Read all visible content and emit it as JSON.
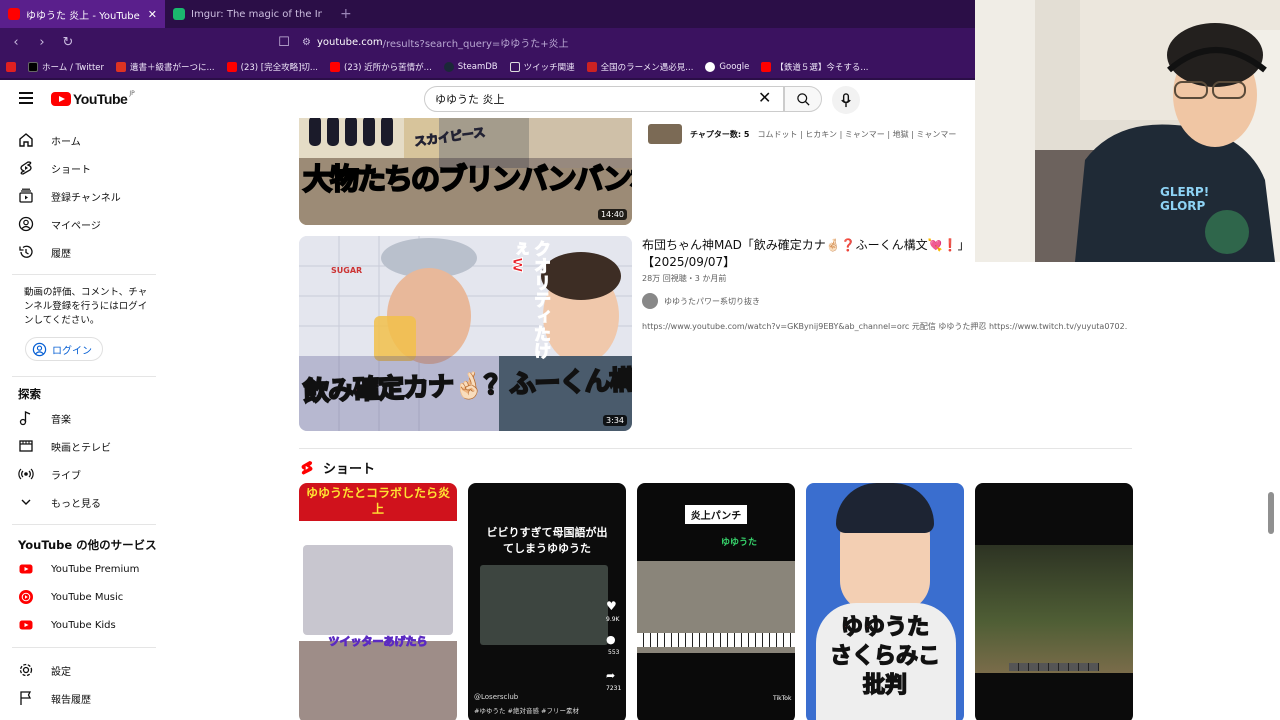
{
  "browser": {
    "tabs": [
      {
        "label": "ゆゆうた 炎上 - YouTube",
        "active": true,
        "favicon_color": "#ff0000"
      },
      {
        "label": "Imgur: The magic of the Internet",
        "active": false,
        "favicon_color": "#1bb76e"
      }
    ],
    "url_host": "youtube.com",
    "url_path": "/results?search_query=ゆゆうた+炎上",
    "bookmarks": [
      {
        "label": "ホーム / Twitter",
        "icon": "x-icon"
      },
      {
        "label": "遺書＋級書がーつに...",
        "icon": "bookmark-red-icon"
      },
      {
        "label": "(23) [完全攻略]切...",
        "icon": "youtube-icon"
      },
      {
        "label": "(23) 近所から苦情が...",
        "icon": "youtube-icon"
      },
      {
        "label": "SteamDB",
        "icon": "steam-icon"
      },
      {
        "label": "ツイッチ関連",
        "icon": "folder-icon"
      },
      {
        "label": "全国のラーメン遇必見...",
        "icon": "ramen-icon"
      },
      {
        "label": "Google",
        "icon": "google-icon"
      },
      {
        "label": "【鉄道５選】今そする...",
        "icon": "youtube-icon"
      }
    ]
  },
  "yt": {
    "logo_text": "YouTube",
    "logo_region": "JP",
    "search_query": "ゆゆうた 炎上"
  },
  "sidebar": {
    "main_items": [
      {
        "label": "ホーム",
        "icon": "home-icon"
      },
      {
        "label": "ショート",
        "icon": "shorts-icon"
      },
      {
        "label": "登録チャンネル",
        "icon": "subscriptions-icon"
      },
      {
        "label": "マイページ",
        "icon": "profile-icon"
      },
      {
        "label": "履歴",
        "icon": "history-icon"
      }
    ],
    "login_prompt": "動画の評価、コメント、チャンネル登録を行うにはログインしてください。",
    "login_button": "ログイン",
    "explore_heading": "探索",
    "explore_items": [
      {
        "label": "音楽",
        "icon": "music-icon"
      },
      {
        "label": "映画とテレビ",
        "icon": "movies-icon"
      },
      {
        "label": "ライブ",
        "icon": "live-icon"
      },
      {
        "label": "もっと見る",
        "icon": "chevron-down-icon"
      }
    ],
    "more_heading": "YouTube の他のサービス",
    "more_items": [
      {
        "label": "YouTube Premium"
      },
      {
        "label": "YouTube Music"
      },
      {
        "label": "YouTube Kids"
      }
    ],
    "bottom_items": [
      {
        "label": "設定",
        "icon": "gear-icon"
      },
      {
        "label": "報告履歴",
        "icon": "flag-icon"
      }
    ]
  },
  "results": {
    "video1": {
      "duration": "14:40",
      "thumb_text": "大物たちのブリンバンバンボン",
      "thumb_tag": "スカイピース",
      "chapters_label": "チャプター数: 5",
      "chapters": "コムドット | ヒカキン | ミャンマー | 地獄 | ミャンマー"
    },
    "video2": {
      "duration": "3:34",
      "title_line1": "布団ちゃん神MAD「飲み確定カナ🤞🏻❓ふーくん構文💘❗」",
      "title_line2": "【2025/09/07】",
      "meta": "28万 回視聴・3 か月前",
      "channel": "ゆゆうたパワー系切り抜き",
      "description": "https://www.youtube.com/watch?v=GKBynij9EBY&ab_channel=orc 元配信 ゆゆうた押忍 https://www.twitch.tv/yuyuta0702.",
      "thumb_text": "飲み確定カナ🤞🏻？ふーくん構文💘！",
      "thumb_side": "クオリティたけぇw",
      "thumb_jar": "SUGAR"
    }
  },
  "shorts": {
    "heading": "ショート",
    "items": [
      {
        "top_text": "ゆゆうたとコラボしたら炎上",
        "bottom_text": "ツイッターあげたら"
      },
      {
        "top_text": "ビビりすぎて母国語が出てしまうゆゆうた",
        "bottom_text": "#ゆゆうた #絶対音感 #フリー素材",
        "handle": "@Losersclub",
        "likes": "9.9K",
        "comments": "553",
        "shares": "7231"
      },
      {
        "top_text": "炎上パンチ",
        "sub_text": "ゆゆうた",
        "badge": "TikTok"
      },
      {
        "top_text": "ゆゆうた",
        "mid_text": "さくらみこ",
        "bottom_text": "批判"
      },
      {
        "top_text": ""
      }
    ]
  },
  "colors": {
    "browser_dark": "#2b0e47",
    "browser_bar": "#3b1260",
    "yt_red": "#ff0000",
    "link_blue": "#065fd4"
  }
}
